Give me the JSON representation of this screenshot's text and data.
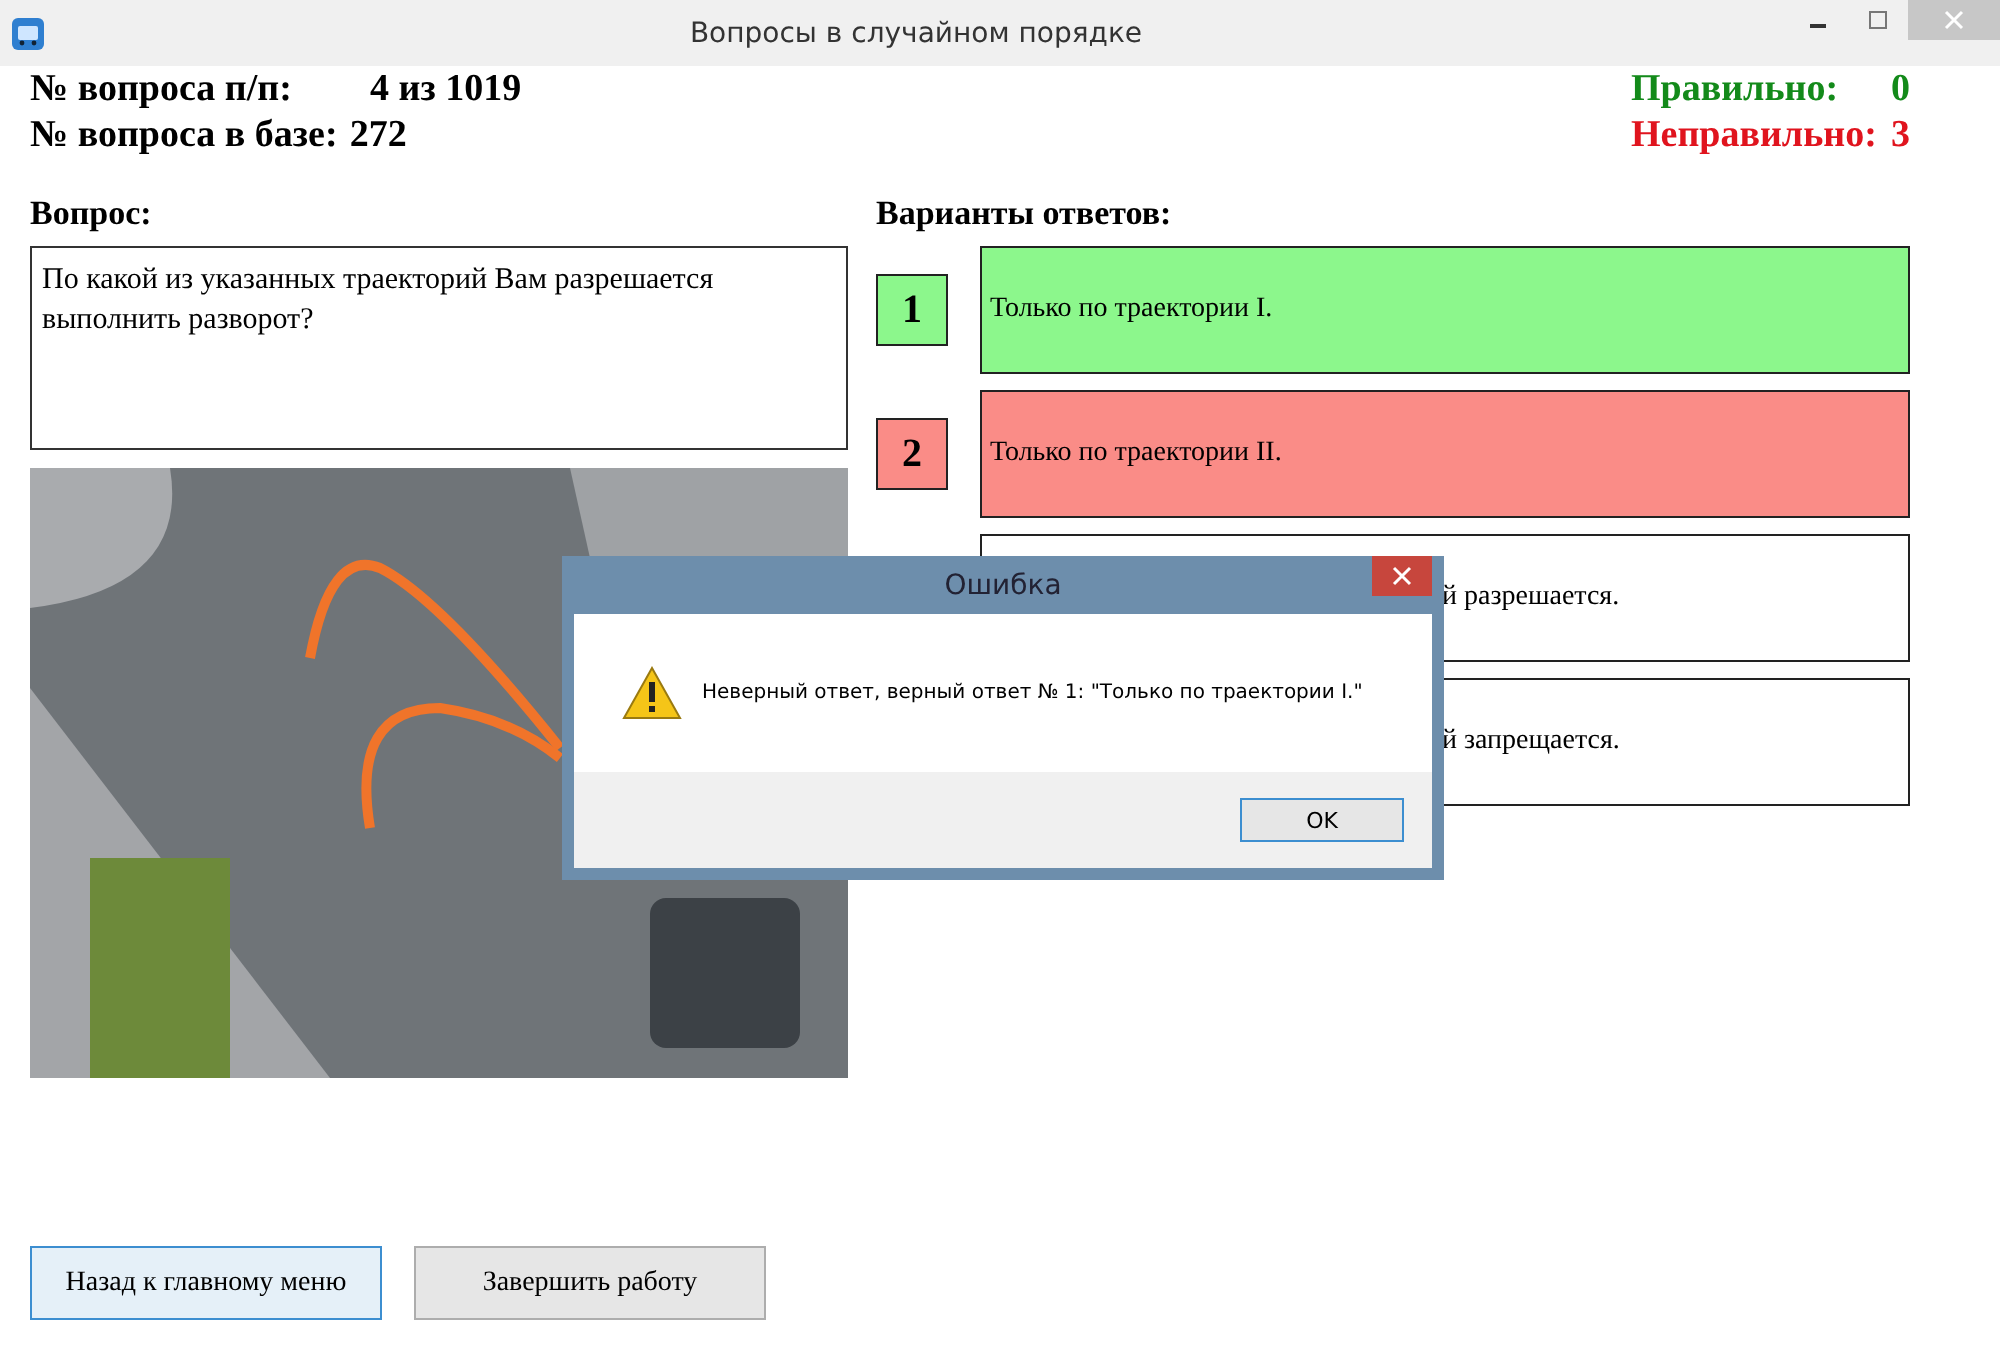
{
  "window": {
    "title": "Вопросы в случайном порядке"
  },
  "info": [
    {
      "label": "№ вопроса п/п:",
      "value": "4 из 1019"
    },
    {
      "label": "№ вопроса в базе:",
      "value": "272"
    }
  ],
  "score": [
    {
      "label": "Правильно:",
      "value": "0",
      "color": "#138a1a"
    },
    {
      "label": "Неправильно:",
      "value": "3",
      "color": "#e0141e"
    }
  ],
  "question": {
    "heading": "Вопрос:",
    "text": "По какой из указанных траекторий Вам разрешается выполнить разворот?"
  },
  "answers_heading": "Варианты ответов:",
  "answers": [
    {
      "number": "1",
      "text": "Только по траектории I.",
      "correct": true,
      "wrong": false
    },
    {
      "number": "2",
      "text": "Только по траектории II.",
      "correct": false,
      "wrong": true
    },
    {
      "text": "й разрешается.",
      "correct": false,
      "wrong": false
    },
    {
      "text": "й запрещается.",
      "correct": false,
      "wrong": false
    }
  ],
  "buttons": [
    "Назад к главному меню",
    "Завершить работу"
  ],
  "dialog": {
    "title": "Ошибка",
    "message": "Неверный ответ, верный ответ № 1: \"Только по траектории I.\"",
    "button": "OK"
  }
}
